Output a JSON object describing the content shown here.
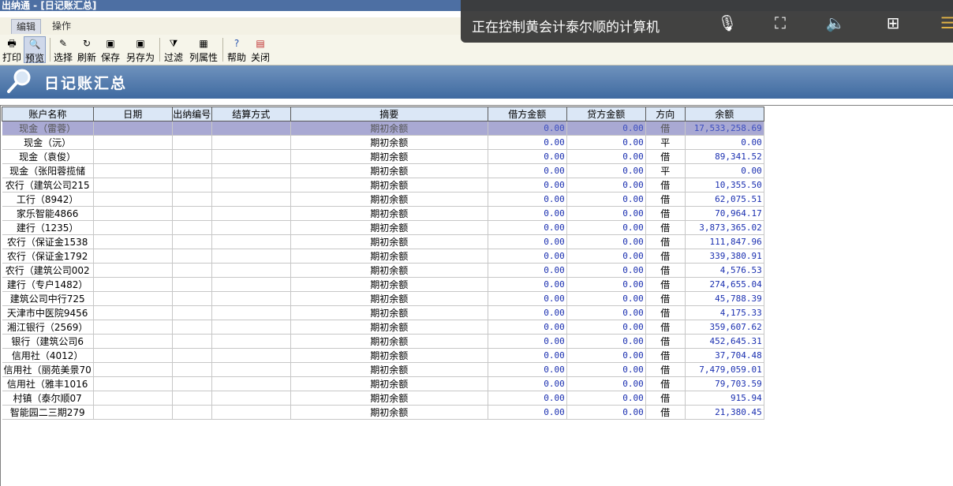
{
  "window": {
    "title": "出纳通 - [日记账汇总]"
  },
  "menu": {
    "tabs": [
      "编辑",
      "操作"
    ]
  },
  "toolbar": {
    "buttons": [
      {
        "label": "打印",
        "icon": "printer-icon"
      },
      {
        "label": "预览",
        "icon": "preview-icon"
      },
      {
        "label": "选择",
        "icon": "select-icon"
      },
      {
        "label": "刷新",
        "icon": "refresh-icon"
      },
      {
        "label": "保存",
        "icon": "save-icon"
      },
      {
        "label": "另存为",
        "icon": "save-as-icon"
      },
      {
        "label": "过滤",
        "icon": "filter-icon"
      },
      {
        "label": "列属性",
        "icon": "column-props-icon"
      },
      {
        "label": "帮助",
        "icon": "help-icon"
      },
      {
        "label": "关闭",
        "icon": "close-icon"
      }
    ]
  },
  "banner": {
    "title": "日记账汇总"
  },
  "remote_overlay": {
    "text": "正在控制黄会计泰尔顺的计算机"
  },
  "table": {
    "columns": [
      "账户名称",
      "日期",
      "出纳编号",
      "结算方式",
      "摘要",
      "借方金额",
      "贷方金额",
      "方向",
      "余额"
    ],
    "rows": [
      {
        "name": "现金（雷蓉）",
        "summary": "期初余额",
        "debit": "0.00",
        "credit": "0.00",
        "dir": "借",
        "balance": "17,533,258.69"
      },
      {
        "name": "现金（沅）",
        "summary": "期初余额",
        "debit": "0.00",
        "credit": "0.00",
        "dir": "平",
        "balance": "0.00"
      },
      {
        "name": "现金（袁俊）",
        "summary": "期初余额",
        "debit": "0.00",
        "credit": "0.00",
        "dir": "借",
        "balance": "89,341.52"
      },
      {
        "name": "现金（张阳蓉揽储",
        "summary": "期初余额",
        "debit": "0.00",
        "credit": "0.00",
        "dir": "平",
        "balance": "0.00"
      },
      {
        "name": "农行（建筑公司215",
        "summary": "期初余额",
        "debit": "0.00",
        "credit": "0.00",
        "dir": "借",
        "balance": "10,355.50"
      },
      {
        "name": "工行（8942）",
        "summary": "期初余额",
        "debit": "0.00",
        "credit": "0.00",
        "dir": "借",
        "balance": "62,075.51"
      },
      {
        "name": "家乐智能4866",
        "summary": "期初余额",
        "debit": "0.00",
        "credit": "0.00",
        "dir": "借",
        "balance": "70,964.17"
      },
      {
        "name": "建行（1235）",
        "summary": "期初余额",
        "debit": "0.00",
        "credit": "0.00",
        "dir": "借",
        "balance": "3,873,365.02"
      },
      {
        "name": "农行（保证金1538",
        "summary": "期初余额",
        "debit": "0.00",
        "credit": "0.00",
        "dir": "借",
        "balance": "111,847.96"
      },
      {
        "name": "农行（保证金1792",
        "summary": "期初余额",
        "debit": "0.00",
        "credit": "0.00",
        "dir": "借",
        "balance": "339,380.91"
      },
      {
        "name": "农行（建筑公司002",
        "summary": "期初余额",
        "debit": "0.00",
        "credit": "0.00",
        "dir": "借",
        "balance": "4,576.53"
      },
      {
        "name": "建行（专户1482）",
        "summary": "期初余额",
        "debit": "0.00",
        "credit": "0.00",
        "dir": "借",
        "balance": "274,655.04"
      },
      {
        "name": "建筑公司中行725",
        "summary": "期初余额",
        "debit": "0.00",
        "credit": "0.00",
        "dir": "借",
        "balance": "45,788.39"
      },
      {
        "name": "天津市中医院9456",
        "summary": "期初余额",
        "debit": "0.00",
        "credit": "0.00",
        "dir": "借",
        "balance": "4,175.33"
      },
      {
        "name": "湘江银行（2569）",
        "summary": "期初余额",
        "debit": "0.00",
        "credit": "0.00",
        "dir": "借",
        "balance": "359,607.62"
      },
      {
        "name": "银行（建筑公司6",
        "summary": "期初余额",
        "debit": "0.00",
        "credit": "0.00",
        "dir": "借",
        "balance": "452,645.31"
      },
      {
        "name": "信用社（4012）",
        "summary": "期初余额",
        "debit": "0.00",
        "credit": "0.00",
        "dir": "借",
        "balance": "37,704.48"
      },
      {
        "name": "信用社（丽苑美景70",
        "summary": "期初余额",
        "debit": "0.00",
        "credit": "0.00",
        "dir": "借",
        "balance": "7,479,059.01"
      },
      {
        "name": "信用社（雅丰1016",
        "summary": "期初余额",
        "debit": "0.00",
        "credit": "0.00",
        "dir": "借",
        "balance": "79,703.59"
      },
      {
        "name": "村镇（泰尔顺07",
        "summary": "期初余额",
        "debit": "0.00",
        "credit": "0.00",
        "dir": "借",
        "balance": "915.94"
      },
      {
        "name": "智能园二三期279",
        "summary": "期初余额",
        "debit": "0.00",
        "credit": "0.00",
        "dir": "借",
        "balance": "21,380.45"
      }
    ]
  }
}
